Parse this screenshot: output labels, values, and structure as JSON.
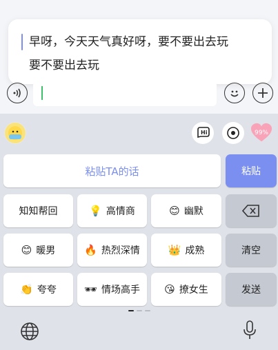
{
  "bubble": {
    "line1": "早呀，今天天气真好呀，要不要出去玩",
    "line2": "要不要出去玩"
  },
  "input": {
    "value": ""
  },
  "toolbar": {
    "voice_icon": "voice-wave-icon",
    "emoji_icon": "smiley-icon",
    "add_icon": "plus-icon"
  },
  "keyboard": {
    "badge_text": "99%",
    "paste_placeholder": "粘贴TA的话",
    "paste_label": "粘贴",
    "clear_label": "清空",
    "send_label": "发送",
    "styles": [
      {
        "emoji": "",
        "label": "知知帮回"
      },
      {
        "emoji": "💡",
        "label": "高情商"
      },
      {
        "emoji": "😊",
        "label": "幽默"
      },
      {
        "emoji": "😊",
        "label": "暖男"
      },
      {
        "emoji": "🔥",
        "label": "热烈深情"
      },
      {
        "emoji": "👑",
        "label": "成熟"
      },
      {
        "emoji": "👏",
        "label": "夸夸"
      },
      {
        "emoji": "🕶",
        "label": "情场高手"
      },
      {
        "emoji": "😘",
        "label": "撩女生"
      }
    ]
  },
  "colors": {
    "accent": "#7b8ff0",
    "cursor": "#3dbf6c",
    "keyboard_bg": "#dfe2e8"
  }
}
